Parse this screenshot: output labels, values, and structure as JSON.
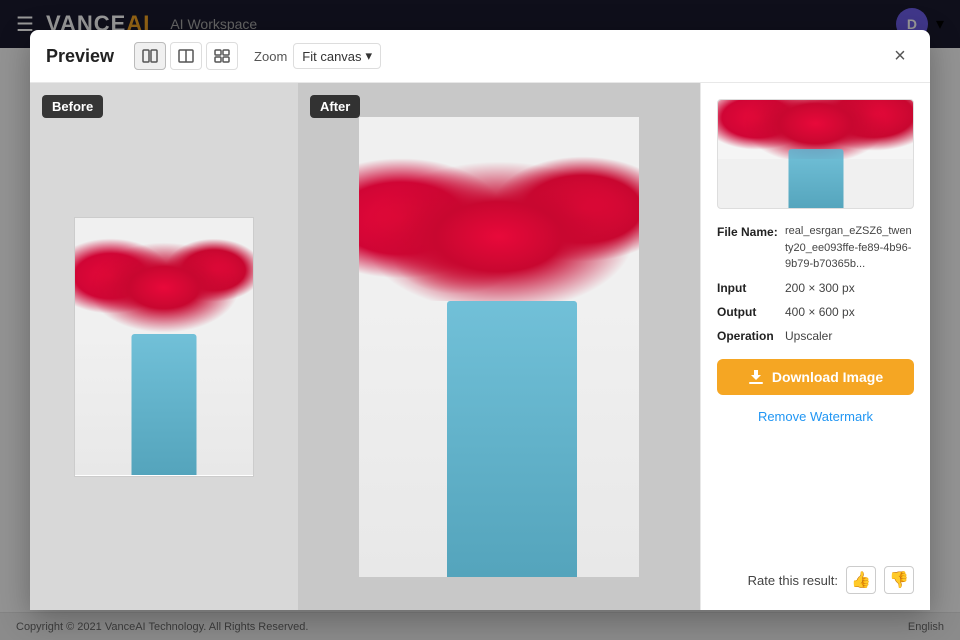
{
  "app": {
    "title": "VANCE AI",
    "title_accent": "AI",
    "workspace_label": "AI Workspace",
    "header_avatar": "D",
    "footer_copyright": "Copyright © 2021 VanceAI Technology. All Rights Reserved.",
    "footer_lang": "English"
  },
  "modal": {
    "title": "Preview",
    "close_label": "×",
    "zoom_label": "Zoom",
    "zoom_value": "Fit canvas",
    "before_label": "Before",
    "after_label": "After"
  },
  "sidebar": {
    "file_name_label": "File Name:",
    "file_name_value": "real_esrgan_eZSZ6_twenty20_ee093ffe-fe89-4b96-9b79-b70365b...",
    "input_label": "Input",
    "input_value": "200 × 300 px",
    "output_label": "Output",
    "output_value": "400 × 600 px",
    "operation_label": "Operation",
    "operation_value": "Upscaler",
    "download_button": "Download Image",
    "remove_watermark": "Remove Watermark",
    "rate_label": "Rate this result:"
  }
}
